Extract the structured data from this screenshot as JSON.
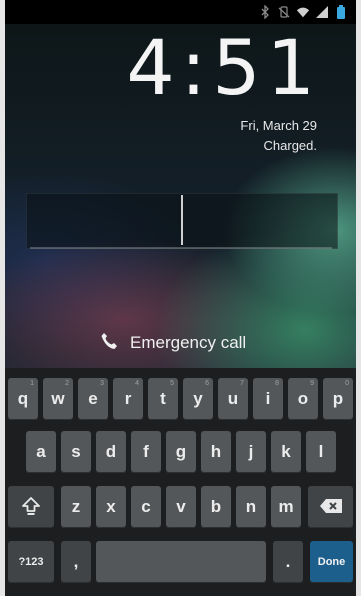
{
  "clock": {
    "time": "4:51"
  },
  "date": {
    "date": "Fri, March 29",
    "battery_status": "Charged."
  },
  "emergency": {
    "label": "Emergency call"
  },
  "keyboard": {
    "row1": [
      {
        "label": "q",
        "hint": "1"
      },
      {
        "label": "w",
        "hint": "2"
      },
      {
        "label": "e",
        "hint": "3"
      },
      {
        "label": "r",
        "hint": "4"
      },
      {
        "label": "t",
        "hint": "5"
      },
      {
        "label": "y",
        "hint": "6"
      },
      {
        "label": "u",
        "hint": "7"
      },
      {
        "label": "i",
        "hint": "8"
      },
      {
        "label": "o",
        "hint": "9"
      },
      {
        "label": "p",
        "hint": "0"
      }
    ],
    "row2": [
      "a",
      "s",
      "d",
      "f",
      "g",
      "h",
      "j",
      "k",
      "l"
    ],
    "row3": [
      "z",
      "x",
      "c",
      "v",
      "b",
      "n",
      "m"
    ],
    "symbols_label": "?123",
    "comma_label": ",",
    "period_label": ".",
    "done_label": "Done"
  }
}
